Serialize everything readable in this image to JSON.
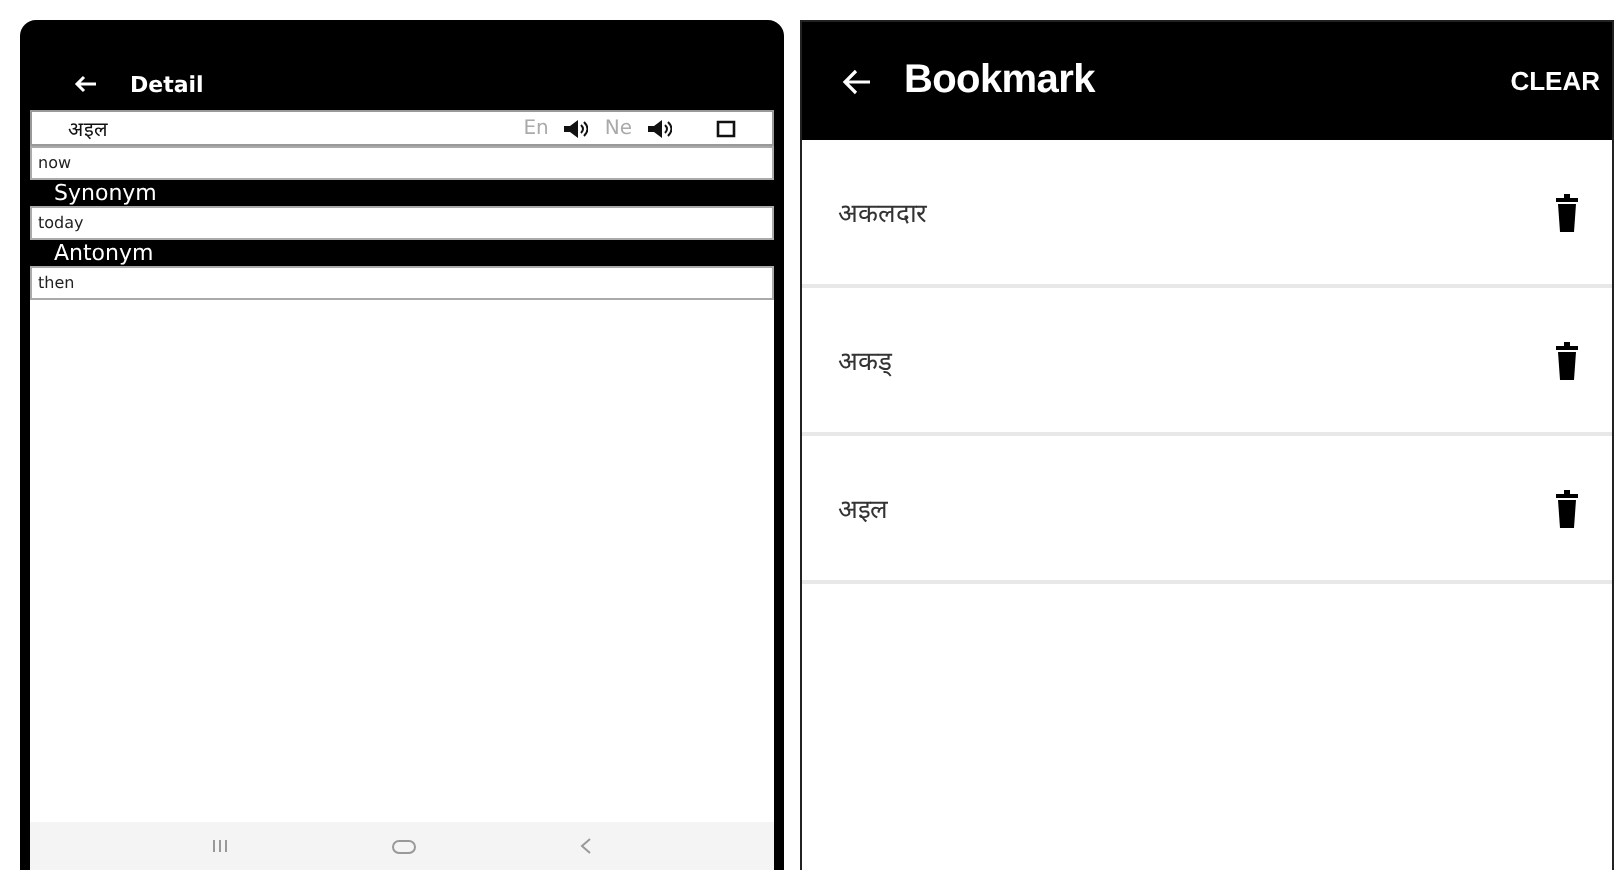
{
  "detail": {
    "title": "Detail",
    "word": "अइल",
    "lang_buttons": [
      "En",
      "Ne"
    ],
    "meaning": "now",
    "sections": [
      {
        "heading": "Synonym",
        "text": "today"
      },
      {
        "heading": "Antonym",
        "text": "then"
      }
    ]
  },
  "bookmark": {
    "title": "Bookmark",
    "action": "CLEAR",
    "items": [
      "अकलदार",
      "अकड्",
      "अइल"
    ]
  }
}
